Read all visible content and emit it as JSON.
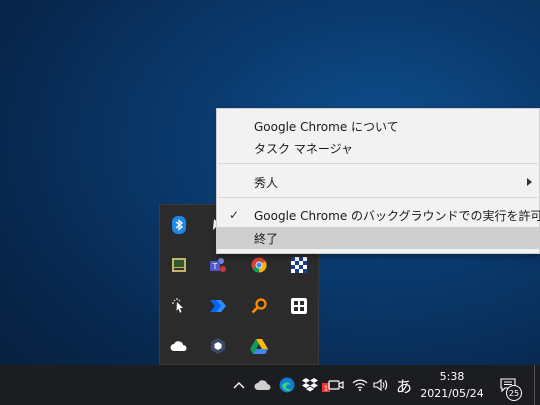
{
  "context_menu": {
    "items": [
      {
        "label": "Google Chrome について"
      },
      {
        "label": "タスク マネージャ"
      },
      {
        "label": "秀人"
      },
      {
        "label": "Google Chrome のバックグラウンドでの実行を許可する",
        "checked": true
      },
      {
        "label": "終了"
      }
    ]
  },
  "tray_flyout": {
    "icons": [
      "bluetooth-icon",
      "cursor-white-icon",
      "display-app-icon",
      "teams-icon",
      "chrome-icon",
      "pattern-app-icon",
      "click-cursor-icon",
      "power-automate-icon",
      "search-magnifier-icon",
      "grid-app-icon",
      "onedrive-icon",
      "box-app-icon",
      "google-drive-icon"
    ]
  },
  "taskbar": {
    "ime_label": "あ",
    "time": "5:38",
    "date": "2021/05/24",
    "notification_count": "25"
  }
}
